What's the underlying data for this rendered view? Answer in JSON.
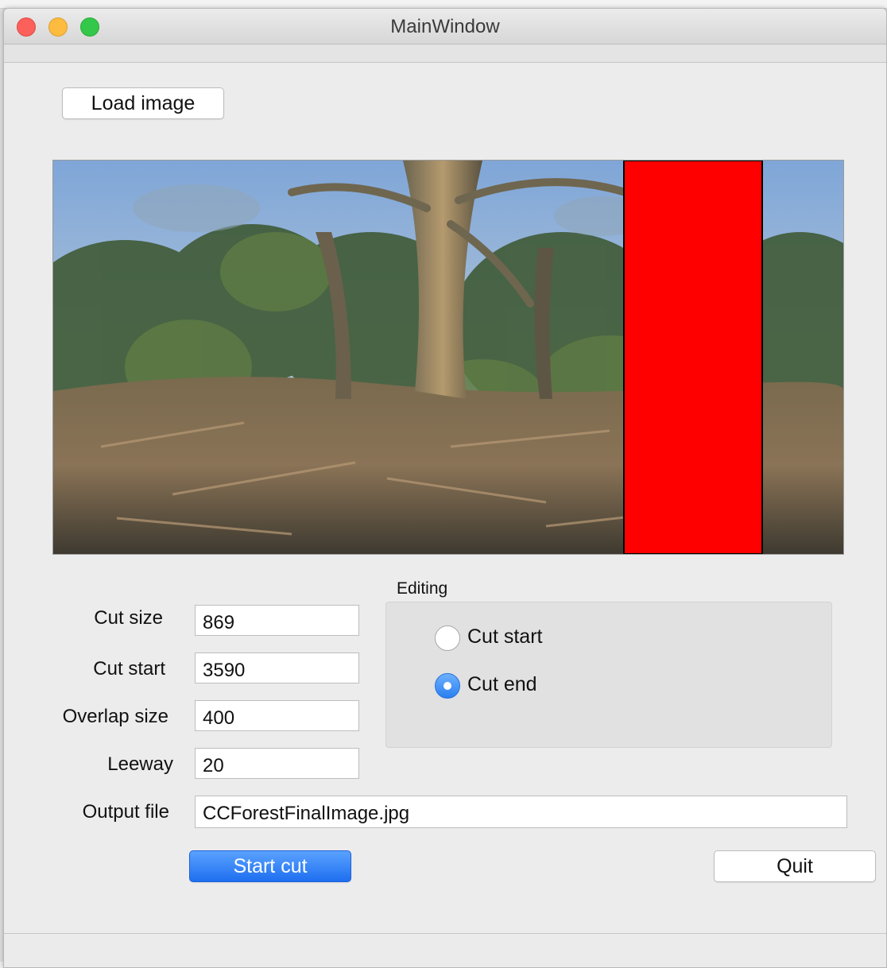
{
  "window": {
    "title": "MainWindow"
  },
  "buttons": {
    "load_image": "Load image",
    "start_cut": "Start cut",
    "quit": "Quit"
  },
  "preview": {
    "description_icon": "forest-panorama-image",
    "cut_marker_color": "#ff0000"
  },
  "fields": {
    "cut_size": {
      "label": "Cut size",
      "value": "869"
    },
    "cut_start": {
      "label": "Cut start",
      "value": "3590"
    },
    "overlap_size": {
      "label": "Overlap size",
      "value": "400"
    },
    "leeway": {
      "label": "Leeway",
      "value": "20"
    },
    "output_file": {
      "label": "Output file",
      "value": "CCForestFinalImage.jpg"
    }
  },
  "editing": {
    "title": "Editing",
    "options": [
      {
        "label": "Cut start",
        "checked": false
      },
      {
        "label": "Cut end",
        "checked": true
      }
    ]
  },
  "colors": {
    "accent": "#2a7ff0",
    "window_bg": "#ececec"
  }
}
